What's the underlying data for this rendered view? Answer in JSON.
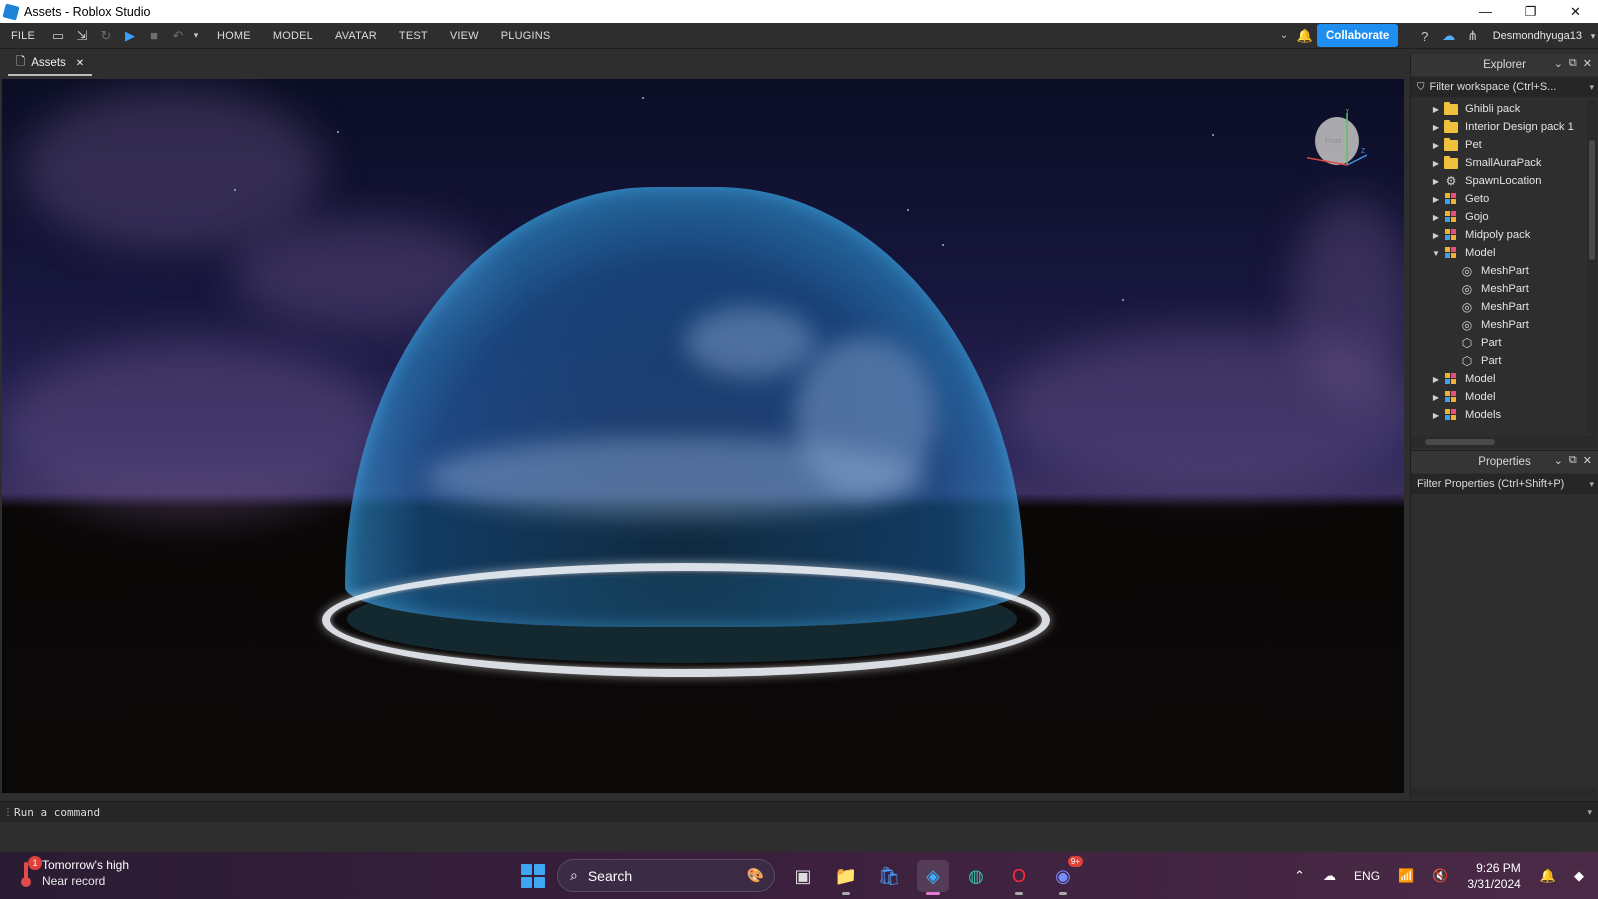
{
  "window": {
    "title": "Assets - Roblox Studio",
    "min_glyph": "—",
    "max_glyph": "❐",
    "close_glyph": "✕"
  },
  "menubar": {
    "file": "FILE",
    "tabs": [
      "HOME",
      "MODEL",
      "AVATAR",
      "TEST",
      "VIEW",
      "PLUGINS"
    ],
    "collaborate": "Collaborate",
    "username": "Desmondhyuga13"
  },
  "doc_tab": {
    "label": "Assets",
    "close_glyph": "✕"
  },
  "explorer": {
    "title": "Explorer",
    "filter_placeholder": "Filter workspace (Ctrl+S...",
    "items": [
      {
        "label": "Ghibli pack",
        "icon": "folder-icon",
        "expand": "closed",
        "indent": 0
      },
      {
        "label": "Interior Design pack 1",
        "icon": "folder-icon",
        "expand": "closed",
        "indent": 0
      },
      {
        "label": "Pet",
        "icon": "folder-icon",
        "expand": "closed",
        "indent": 0
      },
      {
        "label": "SmallAuraPack",
        "icon": "folder-icon",
        "expand": "closed",
        "indent": 0
      },
      {
        "label": "SpawnLocation",
        "icon": "spawn-icon",
        "expand": "closed",
        "indent": 0
      },
      {
        "label": "Geto",
        "icon": "model-icon",
        "expand": "closed",
        "indent": 0
      },
      {
        "label": "Gojo",
        "icon": "model-icon",
        "expand": "closed",
        "indent": 0
      },
      {
        "label": "Midpoly pack",
        "icon": "model-icon",
        "expand": "closed",
        "indent": 0
      },
      {
        "label": "Model",
        "icon": "model-icon",
        "expand": "open",
        "indent": 0
      },
      {
        "label": "MeshPart",
        "icon": "meshpart-icon",
        "expand": "none",
        "indent": 1
      },
      {
        "label": "MeshPart",
        "icon": "meshpart-icon",
        "expand": "none",
        "indent": 1
      },
      {
        "label": "MeshPart",
        "icon": "meshpart-icon",
        "expand": "none",
        "indent": 1
      },
      {
        "label": "MeshPart",
        "icon": "meshpart-icon",
        "expand": "none",
        "indent": 1
      },
      {
        "label": "Part",
        "icon": "part-icon",
        "expand": "none",
        "indent": 1
      },
      {
        "label": "Part",
        "icon": "part-icon",
        "expand": "none",
        "indent": 1
      },
      {
        "label": "Model",
        "icon": "model-icon",
        "expand": "closed",
        "indent": 0
      },
      {
        "label": "Model",
        "icon": "model-icon",
        "expand": "closed",
        "indent": 0
      },
      {
        "label": "Models",
        "icon": "model-icon",
        "expand": "closed",
        "indent": 0
      }
    ]
  },
  "properties": {
    "title": "Properties",
    "filter_placeholder": "Filter Properties (Ctrl+Shift+P)"
  },
  "viewport": {
    "cube_label": "Front",
    "axis_x": "X",
    "axis_y": "Y",
    "axis_z": "Z"
  },
  "command_bar": {
    "placeholder": "Run a command"
  },
  "taskbar": {
    "weather_title": "Tomorrow's high",
    "weather_sub": "Near record",
    "weather_badge": "1",
    "search_label": "Search",
    "discord_badge": "9+",
    "lang": "ENG",
    "time": "9:26 PM",
    "date": "3/31/2024"
  },
  "colors": {
    "accent": "#1f8ef1",
    "folder": "#f0c23b",
    "dome": "#3aaee8"
  }
}
